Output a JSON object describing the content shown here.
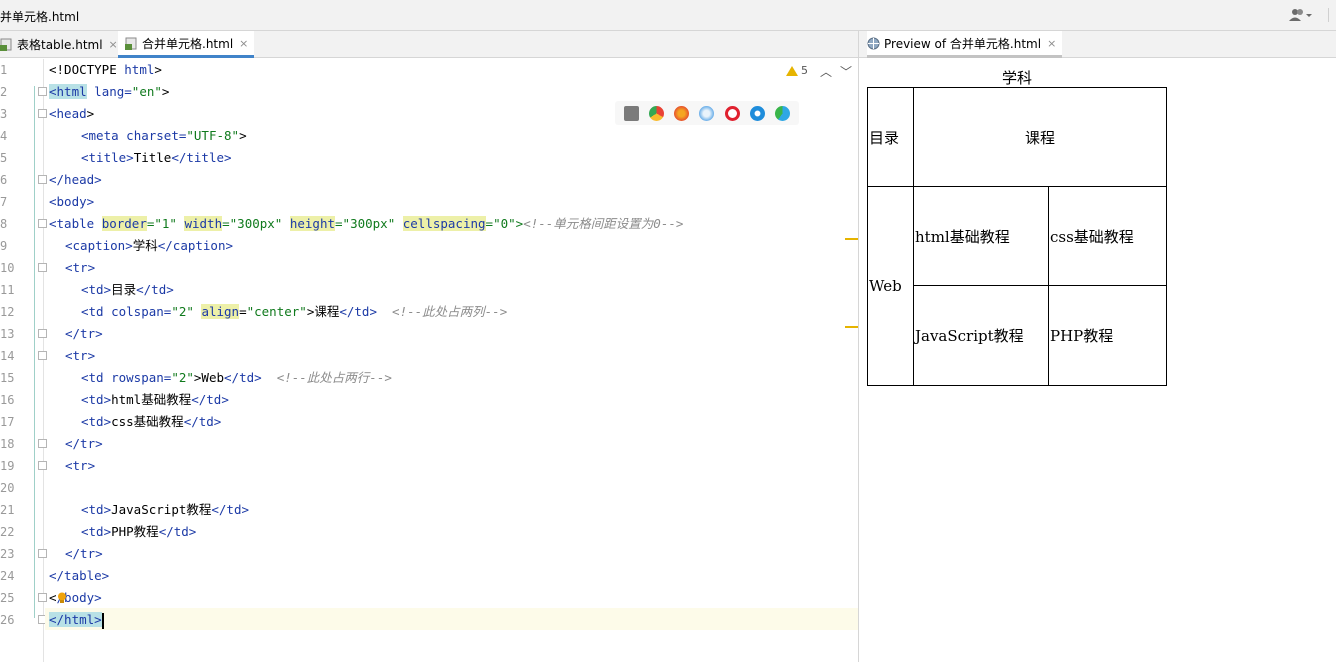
{
  "window": {
    "title": "并单元格.html"
  },
  "editor_tabs": [
    {
      "label": "表格table.html",
      "close": "×",
      "active": false
    },
    {
      "label": "合并单元格.html",
      "close": "×",
      "active": true
    }
  ],
  "preview_tab": {
    "label": "Preview of 合并单元格.html",
    "close": "×"
  },
  "inspections": {
    "warning_count": "5"
  },
  "code_lines": [
    [
      "<!DOCTYPE ",
      "html",
      ">"
    ],
    [
      "<html",
      " lang=",
      "\"en\"",
      ">"
    ],
    [
      "<head",
      ">"
    ],
    [
      "<meta",
      " charset=",
      "\"UTF-8\"",
      ">"
    ],
    [
      "<title>",
      "Title",
      "</title>"
    ],
    [
      "</head>"
    ],
    [
      "<body>"
    ],
    [
      "<table ",
      "border",
      "=\"1\" ",
      "width",
      "=\"300px\" ",
      "height",
      "=\"300px\" ",
      "cellspacing",
      "=\"0\">",
      "<!--单元格间距设置为0-->"
    ],
    [
      "<caption>",
      "学科",
      "</caption>"
    ],
    [
      "<tr>"
    ],
    [
      "<td>",
      "目录",
      "</td>"
    ],
    [
      "<td ",
      "colspan=",
      "\"2\" ",
      "align",
      "=",
      "\"center\"",
      ">课程",
      "</td>",
      "  <!--此处占两列-->"
    ],
    [
      "</tr>"
    ],
    [
      "<tr>"
    ],
    [
      "<td ",
      "rowspan=",
      "\"2\"",
      ">Web",
      "</td>",
      "  <!--此处占两行-->"
    ],
    [
      "<td>",
      "html基础教程",
      "</td>"
    ],
    [
      "<td>",
      "css基础教程",
      "</td>"
    ],
    [
      "</tr>"
    ],
    [
      "<tr>"
    ],
    [
      ""
    ],
    [
      "<td>",
      "JavaScript教程",
      "</td>"
    ],
    [
      "<td>",
      "PHP教程",
      "</td>"
    ],
    [
      "</tr>"
    ],
    [
      "</table>"
    ],
    [
      "<",
      "/body>"
    ],
    [
      "</html>"
    ]
  ],
  "line_numbers": [
    "1",
    "2",
    "3",
    "4",
    "5",
    "6",
    "7",
    "8",
    "9",
    "10",
    "11",
    "12",
    "13",
    "14",
    "15",
    "16",
    "17",
    "18",
    "19",
    "20",
    "21",
    "22",
    "23",
    "24",
    "25",
    "26"
  ],
  "browsers": [
    "intellij-icon",
    "chrome-icon",
    "firefox-icon",
    "safari-icon",
    "opera-icon",
    "ie-icon",
    "edge-icon"
  ],
  "preview": {
    "caption": "学科",
    "rows": [
      [
        "目录",
        "课程"
      ],
      [
        "Web",
        "html基础教程",
        "css基础教程"
      ],
      [
        "JavaScript教程",
        "PHP教程"
      ]
    ]
  },
  "colors": {
    "tag": "#1c3aa6",
    "value": "#107a1d",
    "comment": "#8c8c8c",
    "active_tab_underline": "#4083c9",
    "warning": "#e6b400"
  }
}
